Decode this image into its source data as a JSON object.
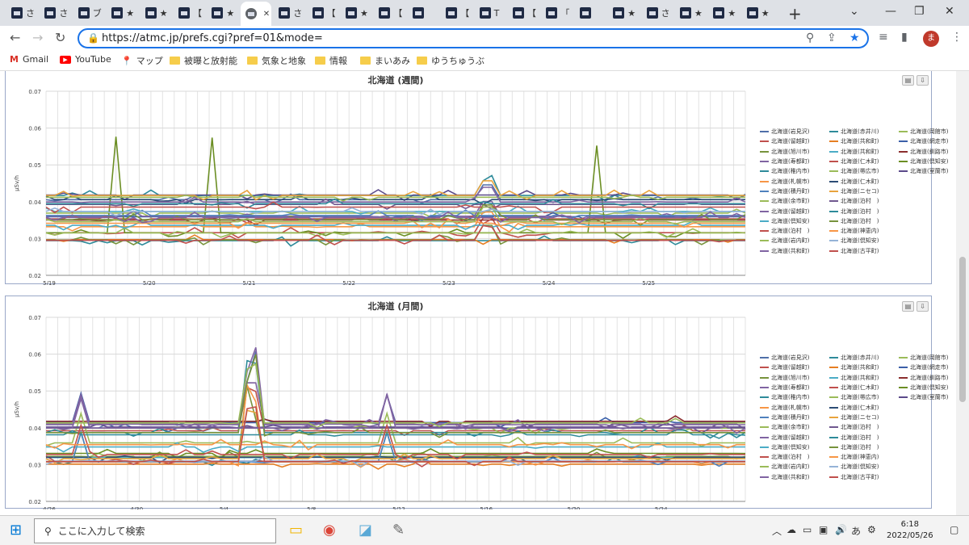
{
  "browser": {
    "tabs": [
      {
        "label": "さ"
      },
      {
        "label": "さ"
      },
      {
        "label": "ブ"
      },
      {
        "label": "★"
      },
      {
        "label": "★"
      },
      {
        "label": "【"
      },
      {
        "label": "★"
      },
      {
        "label": "",
        "active": true
      },
      {
        "label": "さ"
      },
      {
        "label": "【"
      },
      {
        "label": "★"
      },
      {
        "label": "【"
      },
      {
        "label": ""
      },
      {
        "label": "【"
      },
      {
        "label": "T"
      },
      {
        "label": "【"
      },
      {
        "label": "「"
      },
      {
        "label": ""
      },
      {
        "label": "★"
      },
      {
        "label": "さ"
      },
      {
        "label": "★"
      },
      {
        "label": "★"
      },
      {
        "label": "★"
      }
    ],
    "url": "https://atmc.jp/prefs.cgi?pref=01&mode=",
    "avatar": "ま",
    "bookmarks": [
      "Gmail",
      "YouTube",
      "マップ",
      "被曝と放射能",
      "気象と地象",
      "情報",
      "まいあみ",
      "ゆうちゅうぶ"
    ]
  },
  "charts": {
    "weekly": {
      "title": "北海道 (週間)",
      "ylabel": "μSv/h",
      "yticks": [
        "0.07",
        "0.06",
        "0.05",
        "0.04",
        "0.03",
        "0.02"
      ],
      "xticks": [
        "5/19",
        "5/20",
        "5/21",
        "5/22",
        "5/23",
        "5/24",
        "5/25"
      ]
    },
    "monthly": {
      "title": "北海道 (月間)",
      "ylabel": "μSv/h",
      "yticks": [
        "0.07",
        "0.06",
        "0.05",
        "0.04",
        "0.03",
        "0.02"
      ],
      "xticks": [
        "4/26",
        "4/30",
        "5/4",
        "5/8",
        "5/12",
        "5/16",
        "5/20",
        "5/24"
      ]
    },
    "legend": [
      [
        "北海道(岩見沢)",
        "北海道(赤井川)",
        "北海道(岡館市)"
      ],
      [
        "北海道(留越町)",
        "北海道(共和町)",
        "北海道(網走市)"
      ],
      [
        "北海道(旭川市)",
        "北海道(共和町)",
        "北海道(釧路市)"
      ],
      [
        "北海道(寿都町)",
        "北海道(仁木町)",
        "北海道(倶知安)"
      ],
      [
        "北海道(稚内市)",
        "北海道(帯広市)",
        "北海道(室蘭市)"
      ],
      [
        "北海道(札幌市)",
        "北海道(仁木町)",
        ""
      ],
      [
        "北海道(積丹町)",
        "北海道(ニセコ)",
        ""
      ],
      [
        "北海道(余市町)",
        "北海道(泊村　)",
        ""
      ],
      [
        "北海道(留越町)",
        "北海道(泊村　)",
        ""
      ],
      [
        "北海道(倶知安)",
        "北海道(泊村　)",
        ""
      ],
      [
        "北海道(泊村　)",
        "北海道(神恵内)",
        ""
      ],
      [
        "北海道(岩内町)",
        "北海道(倶知安)",
        ""
      ],
      [
        "北海道(共和町)",
        "北海道(古平町)",
        ""
      ]
    ],
    "legend_colors": [
      [
        "#4f6fa8",
        "#2e8b9a",
        "#9bbb59"
      ],
      [
        "#c0504d",
        "#e67e22",
        "#3b5fa8"
      ],
      [
        "#77933c",
        "#4bacc6",
        "#8b2e2e"
      ],
      [
        "#8064a2",
        "#c0504d",
        "#6b8e23"
      ],
      [
        "#2e8b9a",
        "#9bbb59",
        "#5b4a8a"
      ],
      [
        "#f79646",
        "#2c4d75",
        ""
      ],
      [
        "#4f81bd",
        "#e8a33d",
        ""
      ],
      [
        "#9bbb59",
        "#70588f",
        ""
      ],
      [
        "#8064a2",
        "#2e8b9a",
        ""
      ],
      [
        "#4bacc6",
        "#77933c",
        ""
      ],
      [
        "#c0504d",
        "#f79646",
        ""
      ],
      [
        "#9bbb59",
        "#95b3d7",
        ""
      ],
      [
        "#8064a2",
        "#c0504d",
        ""
      ]
    ]
  },
  "taskbar": {
    "search_placeholder": "ここに入力して検索",
    "ime": "あ",
    "time": "6:18",
    "date": "2022/05/26"
  }
}
